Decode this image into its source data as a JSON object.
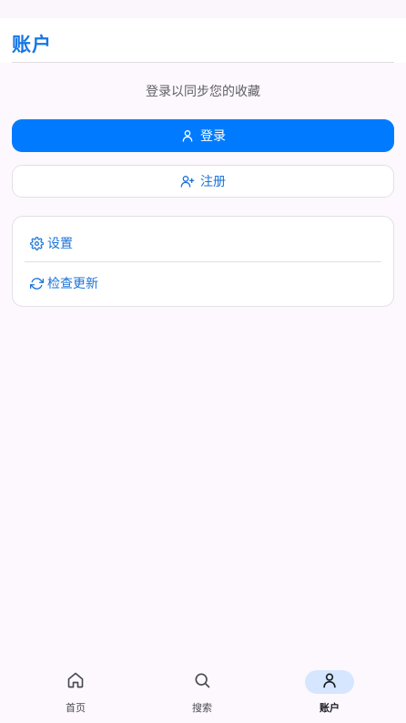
{
  "header": {
    "title": "账户"
  },
  "main": {
    "hint": "登录以同步您的收藏",
    "login_button": {
      "label": "登录",
      "icon": "user-icon"
    },
    "register_button": {
      "label": "注册",
      "icon": "user-plus-icon"
    },
    "settings_card": {
      "items": [
        {
          "label": "设置",
          "icon": "gear-icon"
        },
        {
          "label": "检查更新",
          "icon": "refresh-icon"
        }
      ]
    }
  },
  "bottom_nav": {
    "items": [
      {
        "label": "首页",
        "icon": "home-icon",
        "active": false
      },
      {
        "label": "搜索",
        "icon": "search-icon",
        "active": false
      },
      {
        "label": "账户",
        "icon": "user-icon",
        "active": true
      }
    ]
  },
  "colors": {
    "accent": "#007bff",
    "accent_text": "#1a73d9",
    "nav_active_pill": "#d6e6ff",
    "background": "#fdf8fd"
  }
}
